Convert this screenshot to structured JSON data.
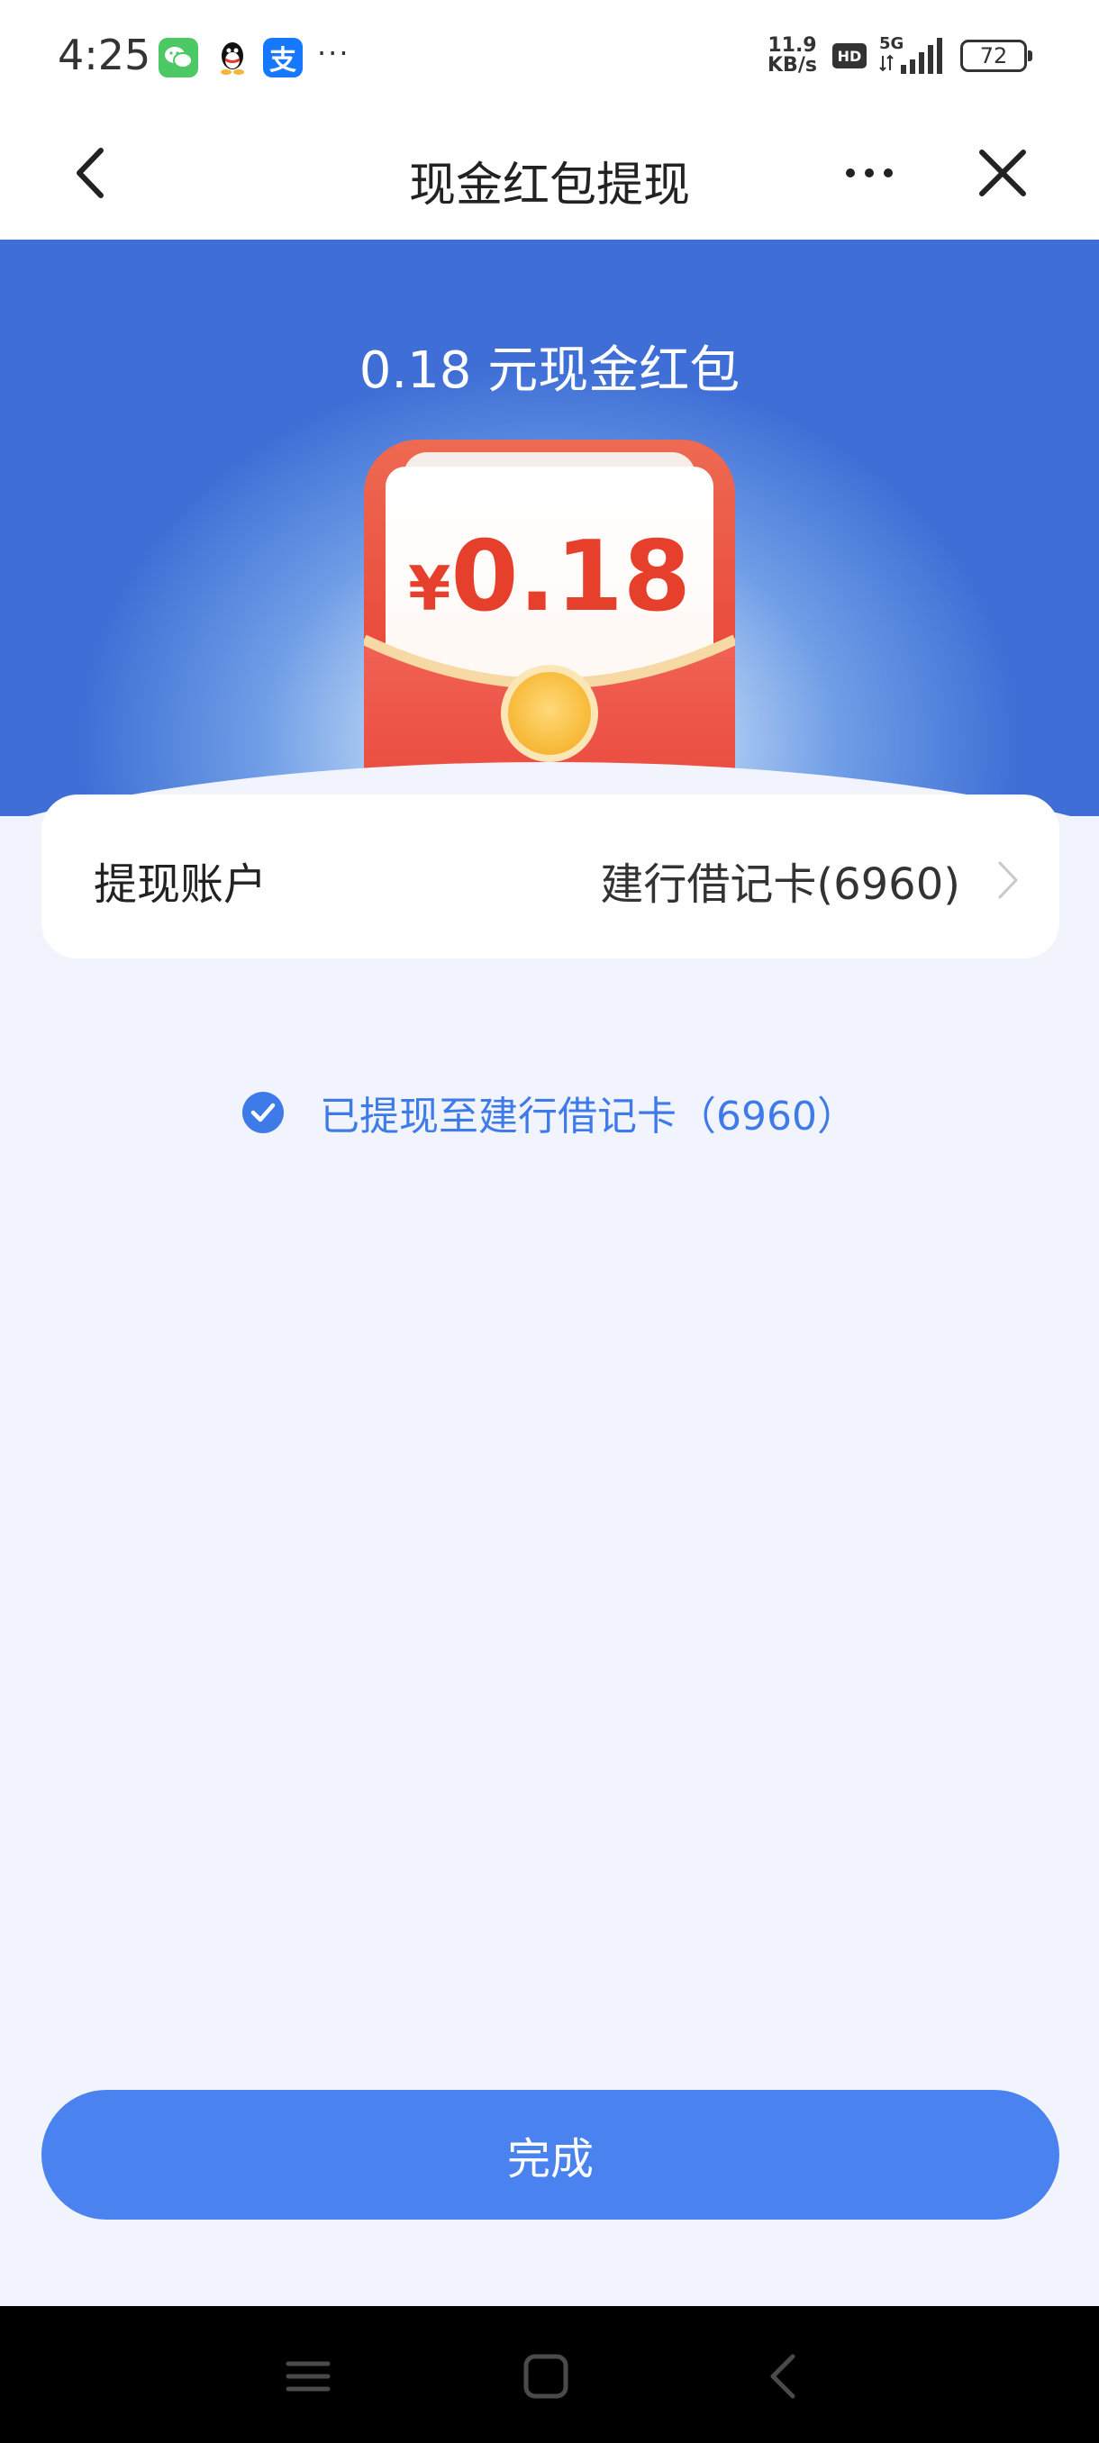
{
  "status_bar": {
    "time": "4:25",
    "network_speed_value": "11.9",
    "network_speed_unit": "KB/s",
    "hd_badge": "HD",
    "network_type": "5G",
    "battery_level": "72",
    "more_notifications": "···",
    "alipay_glyph": "支",
    "icons": [
      "wechat-icon",
      "qq-icon",
      "alipay-icon",
      "signal-icon",
      "battery-icon"
    ]
  },
  "nav": {
    "title": "现金红包提现",
    "back_icon": "chevron-left-icon",
    "more_icon": "more-icon",
    "close_icon": "close-icon"
  },
  "hero": {
    "title": "0.18 元现金红包",
    "currency_symbol": "¥",
    "amount": "0.18"
  },
  "account": {
    "label": "提现账户",
    "value": "建行借记卡(6960)"
  },
  "result": {
    "text": "已提现至建行借记卡（6960）",
    "icon": "check-circle-icon"
  },
  "actions": {
    "done_label": "完成"
  },
  "colors": {
    "accent": "#4a83f0",
    "success_text": "#3e7be8",
    "amount_red": "#e6402c",
    "envelope_red": "#e9473a",
    "page_bg": "#f1f4fc",
    "hero_blue": "#3f6fd6"
  }
}
